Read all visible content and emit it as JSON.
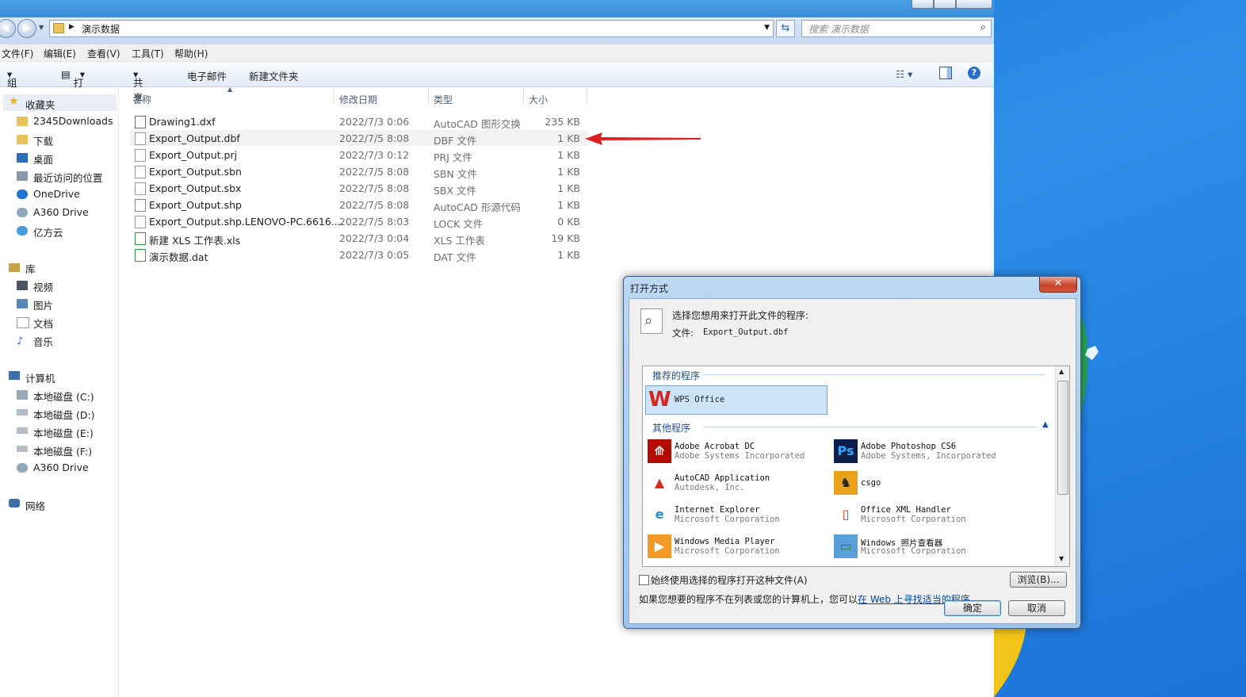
{
  "address": {
    "path": "演示数据",
    "search_placeholder": "搜索 演示数据"
  },
  "menu": [
    "文件(F)",
    "编辑(E)",
    "查看(V)",
    "工具(T)",
    "帮助(H)"
  ],
  "toolbar": {
    "organize": "组织",
    "open": "打开",
    "share": "共享",
    "email": "电子邮件",
    "new_folder": "新建文件夹"
  },
  "nav": {
    "favorites": {
      "label": "收藏夹",
      "items": [
        "2345Downloads",
        "下载",
        "桌面",
        "最近访问的位置",
        "OneDrive",
        "A360 Drive",
        "亿方云"
      ]
    },
    "library": {
      "label": "库",
      "items": [
        "视频",
        "图片",
        "文档",
        "音乐"
      ]
    },
    "computer": {
      "label": "计算机",
      "items": [
        "本地磁盘 (C:)",
        "本地磁盘 (D:)",
        "本地磁盘 (E:)",
        "本地磁盘 (F:)",
        "A360 Drive"
      ]
    },
    "network": {
      "label": "网络"
    }
  },
  "columns": {
    "name": "名称",
    "date": "修改日期",
    "type": "类型",
    "size": "大小"
  },
  "files": [
    {
      "name": "Drawing1.dxf",
      "date": "2022/7/3 0:06",
      "type": "AutoCAD 图形交换",
      "size": "235 KB"
    },
    {
      "name": "Export_Output.dbf",
      "date": "2022/7/5 8:08",
      "type": "DBF 文件",
      "size": "1 KB"
    },
    {
      "name": "Export_Output.prj",
      "date": "2022/7/3 0:12",
      "type": "PRJ 文件",
      "size": "1 KB"
    },
    {
      "name": "Export_Output.sbn",
      "date": "2022/7/5 8:08",
      "type": "SBN 文件",
      "size": "1 KB"
    },
    {
      "name": "Export_Output.sbx",
      "date": "2022/7/5 8:08",
      "type": "SBX 文件",
      "size": "1 KB"
    },
    {
      "name": "Export_Output.shp",
      "date": "2022/7/5 8:08",
      "type": "AutoCAD 形源代码",
      "size": "1 KB"
    },
    {
      "name": "Export_Output.shp.LENOVO-PC.6616....",
      "date": "2022/7/5 8:03",
      "type": "LOCK 文件",
      "size": "0 KB"
    },
    {
      "name": "新建 XLS 工作表.xls",
      "date": "2022/7/3 0:04",
      "type": "XLS 工作表",
      "size": "19 KB"
    },
    {
      "name": "演示数据.dat",
      "date": "2022/7/3 0:05",
      "type": "DAT 文件",
      "size": "1 KB"
    }
  ],
  "dialog": {
    "title": "打开方式",
    "close": "✕",
    "prompt": "选择您想用来打开此文件的程序:",
    "file_label": "文件:",
    "file_name": "Export_Output.dbf",
    "recommended_label": "推荐的程序",
    "recommended": {
      "name": "WPS Office"
    },
    "other_label": "其他程序",
    "programs": [
      {
        "name": "Adobe Acrobat DC",
        "vendor": "Adobe Systems Incorporated"
      },
      {
        "name": "Adobe Photoshop CS6",
        "vendor": "Adobe Systems, Incorporated"
      },
      {
        "name": "AutoCAD Application",
        "vendor": "Autodesk, Inc."
      },
      {
        "name": "csgo",
        "vendor": ""
      },
      {
        "name": "Internet Explorer",
        "vendor": "Microsoft Corporation"
      },
      {
        "name": "Office XML Handler",
        "vendor": "Microsoft Corporation"
      },
      {
        "name": "Windows Media Player",
        "vendor": "Microsoft Corporation"
      },
      {
        "name": "Windows 照片查看器",
        "vendor": "Microsoft Corporation"
      }
    ],
    "always_use": "始终使用选择的程序打开这种文件(A)",
    "browse": "浏览(B)...",
    "hint_prefix": "如果您想要的程序不在列表或您的计算机上，您可以",
    "hint_link": "在 Web 上寻找适当的程序",
    "hint_suffix": "。",
    "ok": "确定",
    "cancel": "取消"
  },
  "colors": {
    "arrow": "#e02020",
    "link": "#0645ad",
    "selection": "#cde3f7",
    "title_blue": "#3a8ed9"
  }
}
